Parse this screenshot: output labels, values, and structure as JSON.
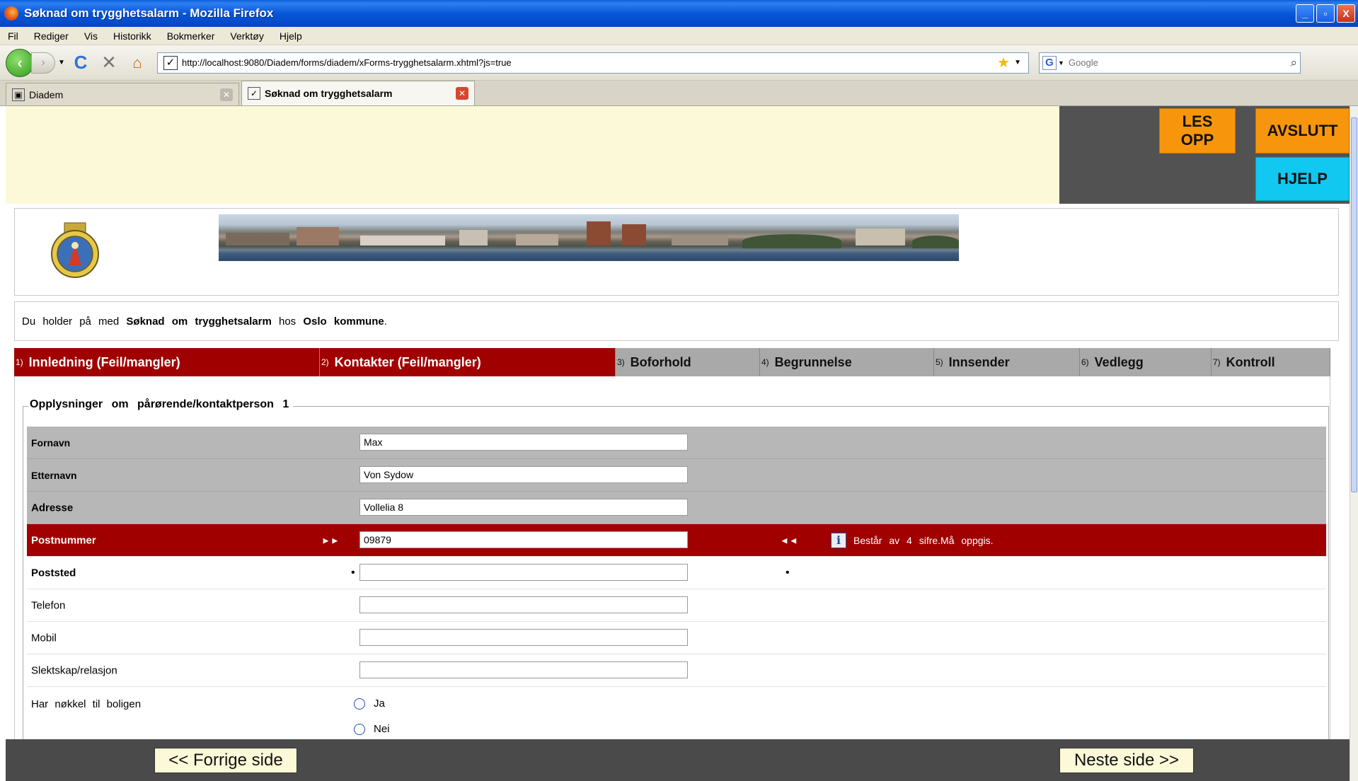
{
  "window": {
    "title": "Søknad om trygghetsalarm - Mozilla Firefox",
    "minimize": "_",
    "maximize": "▫",
    "close": "X"
  },
  "menu": {
    "items": [
      "Fil",
      "Rediger",
      "Vis",
      "Historikk",
      "Bokmerker",
      "Verktøy",
      "Hjelp"
    ]
  },
  "navbar": {
    "url": "http://localhost:9080/Diadem/forms/diadem/xForms-trygghetsalarm.xhtml?js=true",
    "search_placeholder": "Google"
  },
  "tabs": [
    {
      "label": "Diadem",
      "active": false
    },
    {
      "label": "Søknad om trygghetsalarm",
      "active": true
    }
  ],
  "header": {
    "les_opp": "LES OPP",
    "avslutt": "AVSLUTT",
    "hjelp": "HJELP"
  },
  "intro": {
    "prefix": "Du holder på med",
    "form_name": "Søknad om trygghetsalarm",
    "middle": "hos",
    "org": "Oslo kommune",
    "suffix": "."
  },
  "steps": [
    {
      "num": "1)",
      "label": "Innledning (Feil/mangler)",
      "status": "error"
    },
    {
      "num": "2)",
      "label": "Kontakter (Feil/mangler)",
      "status": "error"
    },
    {
      "num": "3)",
      "label": "Boforhold",
      "status": "normal"
    },
    {
      "num": "4)",
      "label": "Begrunnelse",
      "status": "normal"
    },
    {
      "num": "5)",
      "label": "Innsender",
      "status": "normal"
    },
    {
      "num": "6)",
      "label": "Vedlegg",
      "status": "normal"
    },
    {
      "num": "7)",
      "label": "Kontroll",
      "status": "normal"
    }
  ],
  "form": {
    "legend": "Opplysninger om pårørende/kontaktperson 1",
    "fields": [
      {
        "label": "Fornavn",
        "value": "Max"
      },
      {
        "label": "Etternavn",
        "value": "Von Sydow"
      },
      {
        "label": "Adresse",
        "value": "Vollelia 8"
      },
      {
        "label": "Postnummer",
        "value": "09879",
        "mark_left": "►►",
        "mark_right": "◄◄",
        "info": "Består av 4 sifre.Må oppgis."
      },
      {
        "label": "Poststed",
        "value": "",
        "mark_left": "•",
        "mark_right": "•"
      },
      {
        "label": "Telefon",
        "value": ""
      },
      {
        "label": "Mobil",
        "value": ""
      },
      {
        "label": "Slektskap/relasjon",
        "value": ""
      }
    ],
    "key_question": "Har nøkkel til boligen",
    "key_options": [
      "Ja",
      "Nei"
    ]
  },
  "footer": {
    "prev": "<< Forrige side",
    "next": "Neste side >>"
  },
  "colors": {
    "error_red": "#a10000",
    "header_yellow": "#fbf9d8",
    "button_orange": "#f7960c",
    "button_cyan": "#10c8f0"
  }
}
